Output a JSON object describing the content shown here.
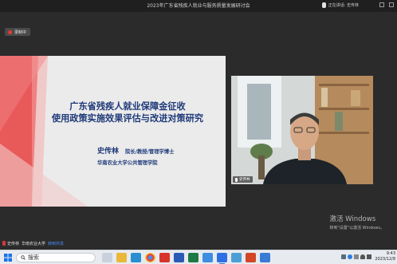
{
  "window": {
    "title": "2023年广东省残疾人就业与服务质量发展研讨会",
    "speaking_label": "正在讲话: 史传林"
  },
  "recording": {
    "label": "录制中"
  },
  "slide": {
    "title_line1": "广东省残疾人就业保障金征收",
    "title_line2": "使用政策实施效果评估与改进对策研究",
    "presenter_name": "史传林",
    "presenter_titles": "院长/教授/管理学博士",
    "presenter_org": "华南农业大学公共管理学院"
  },
  "camera": {
    "name_tag": "史传林"
  },
  "watermark": {
    "line1": "激活 Windows",
    "line2": "转到\"设置\"以激活 Windows。"
  },
  "participants_bar": {
    "entry1": "史传林",
    "entry2": "华南农业大学",
    "link": "转到共享"
  },
  "taskbar": {
    "search_placeholder": "搜索",
    "time": "9:43",
    "date": "2023/12/8"
  },
  "colors": {
    "title_blue": "#1f3a7a",
    "slide_accent_red": "#e85a5a",
    "record_red": "#e53935"
  }
}
